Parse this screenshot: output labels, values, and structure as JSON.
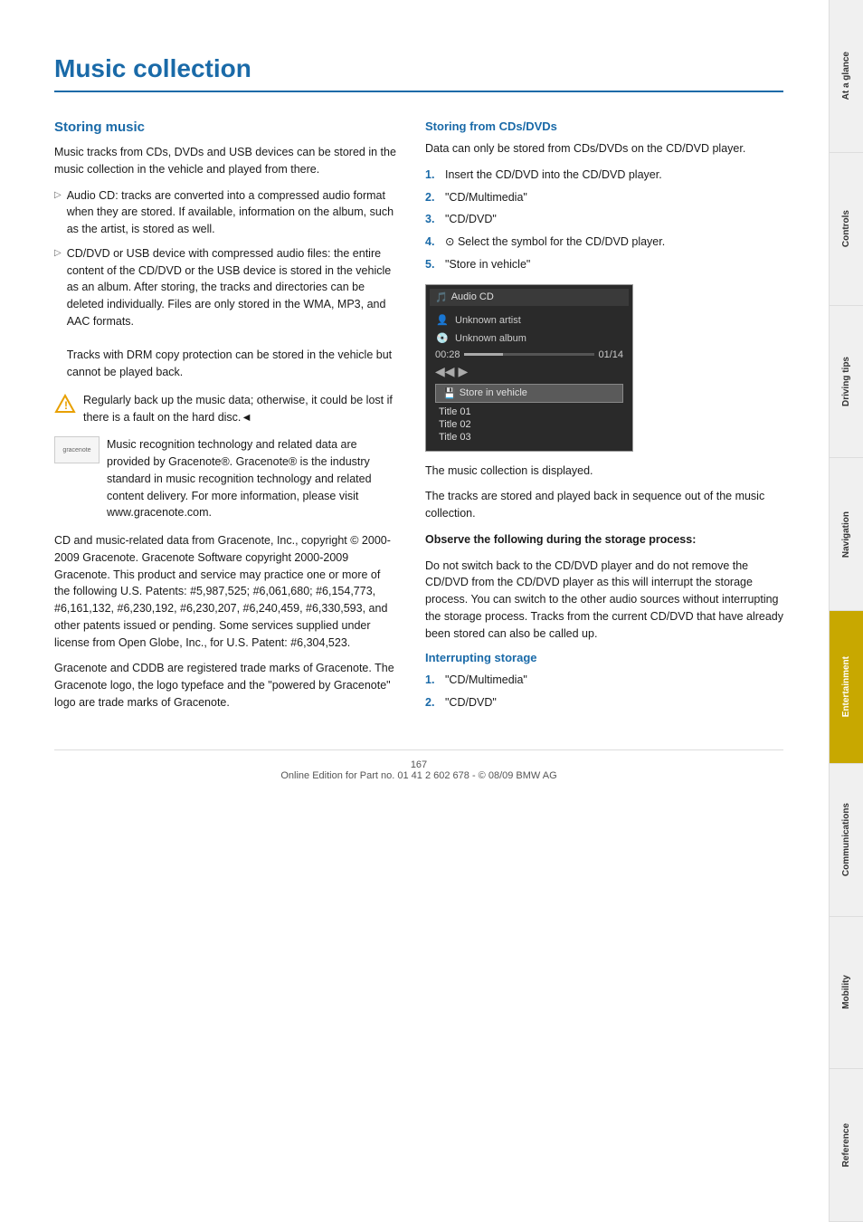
{
  "page": {
    "title": "Music collection",
    "page_number": "167",
    "footer_text": "Online Edition for Part no. 01 41 2 602 678 - © 08/09 BMW AG"
  },
  "left_column": {
    "section_heading": "Storing music",
    "intro_paragraph": "Music tracks from CDs, DVDs and USB devices can be stored in the music collection in the vehicle and played from there.",
    "bullet_items": [
      {
        "id": 0,
        "text": "Audio CD: tracks are converted into a compressed audio format when they are stored. If available, information on the album, such as the artist, is stored as well."
      },
      {
        "id": 1,
        "text": "CD/DVD or USB device with compressed audio files: the entire content of the CD/DVD or the USB device is stored in the vehicle as an album. After storing, the tracks and directories can be deleted individually. Files are only stored in the WMA, MP3, and AAC formats.\nTracks with DRM copy protection can be stored in the vehicle but cannot be played back."
      }
    ],
    "warning_text": "Regularly back up the music data; otherwise, it could be lost if there is a fault on the hard disc.◄",
    "gracenote_intro": "Music recognition technology and related data are provided by Gracenote®. Gracenote® is the industry standard in music recognition technology and related content delivery. For more information, please visit www.gracenote.com.",
    "gracenote_legal": "CD and music-related data from Gracenote, Inc., copyright © 2000-2009 Gracenote. Gracenote Software copyright 2000-2009 Gracenote. This product and service may practice one or more of the following U.S. Patents: #5,987,525; #6,061,680; #6,154,773, #6,161,132, #6,230,192, #6,230,207, #6,240,459, #6,330,593, and other patents issued or pending. Some services supplied under license from Open Globe, Inc., for U.S. Patent: #6,304,523.",
    "gracenote_trademark": "Gracenote and CDDB are registered trade marks of Gracenote. The Gracenote logo, the logo typeface and the \"powered by Gracenote\" logo are trade marks of Gracenote."
  },
  "right_column": {
    "section_heading": "Storing from CDs/DVDs",
    "intro_paragraph": "Data can only be stored from CDs/DVDs on the CD/DVD player.",
    "numbered_steps": [
      {
        "num": "1.",
        "text": "Insert the CD/DVD into the CD/DVD player."
      },
      {
        "num": "2.",
        "text": "\"CD/Multimedia\""
      },
      {
        "num": "3.",
        "text": "\"CD/DVD\""
      },
      {
        "num": "4.",
        "text": "⊙ Select the symbol for the CD/DVD player."
      },
      {
        "num": "5.",
        "text": "\"Store in vehicle\""
      }
    ],
    "cd_ui": {
      "header": "Audio CD",
      "artist": "Unknown artist",
      "album": "Unknown album",
      "time_current": "00:28",
      "time_total": "01/14",
      "store_label": "Store in vehicle",
      "titles": [
        "Title  01",
        "Title  02",
        "Title  03"
      ]
    },
    "after_screenshot_text_1": "The music collection is displayed.",
    "after_screenshot_text_2": "The tracks are stored and played back in sequence out of the music collection.",
    "observe_heading": "Observe the following during the storage process:",
    "observe_text": "Do not switch back to the CD/DVD player and do not remove the CD/DVD from the CD/DVD player as this will interrupt the storage process. You can switch to the other audio sources without interrupting the storage process. Tracks from the current CD/DVD that have already been stored can also be called up.",
    "interrupting_heading": "Interrupting storage",
    "interrupting_steps": [
      {
        "num": "1.",
        "text": "\"CD/Multimedia\""
      },
      {
        "num": "2.",
        "text": "\"CD/DVD\""
      }
    ]
  },
  "sidebar": {
    "tabs": [
      {
        "id": "at-a-glance",
        "label": "At a glance",
        "active": false
      },
      {
        "id": "controls",
        "label": "Controls",
        "active": false
      },
      {
        "id": "driving-tips",
        "label": "Driving tips",
        "active": false
      },
      {
        "id": "navigation",
        "label": "Navigation",
        "active": false
      },
      {
        "id": "entertainment",
        "label": "Entertainment",
        "active": true
      },
      {
        "id": "communications",
        "label": "Communications",
        "active": false
      },
      {
        "id": "mobility",
        "label": "Mobility",
        "active": false
      },
      {
        "id": "reference",
        "label": "Reference",
        "active": false
      }
    ]
  }
}
